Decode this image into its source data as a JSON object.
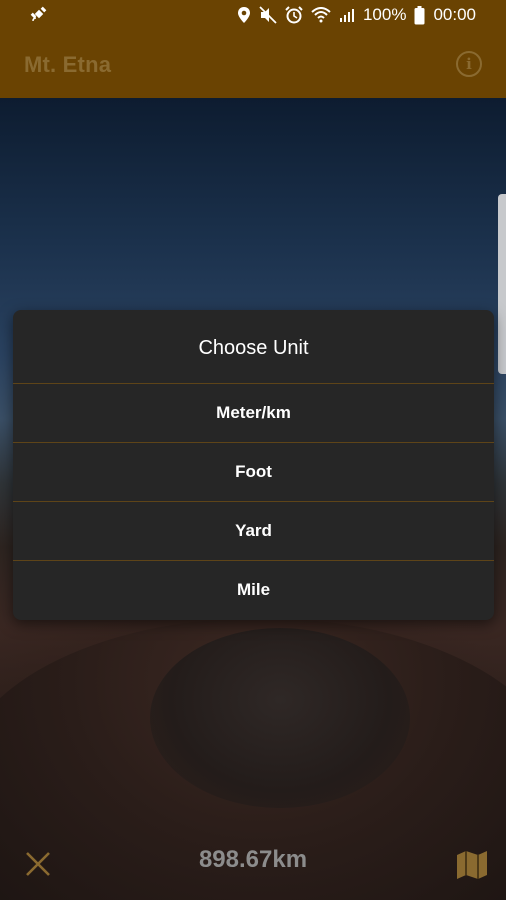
{
  "status_bar": {
    "battery": "100%",
    "time": "00:00"
  },
  "app_bar": {
    "title": "Mt. Etna",
    "info_icon": "info-icon"
  },
  "dialog": {
    "title": "Choose Unit",
    "options": [
      "Meter/km",
      "Foot",
      "Yard",
      "Mile"
    ]
  },
  "bottom_bar": {
    "distance": "898.67km",
    "close_icon": "close-icon",
    "map_icon": "map-icon"
  },
  "colors": {
    "app_bar": "#6a4302",
    "accent": "#8a6a30",
    "dialog_bg": "#262626",
    "divider": "#5e4418"
  }
}
